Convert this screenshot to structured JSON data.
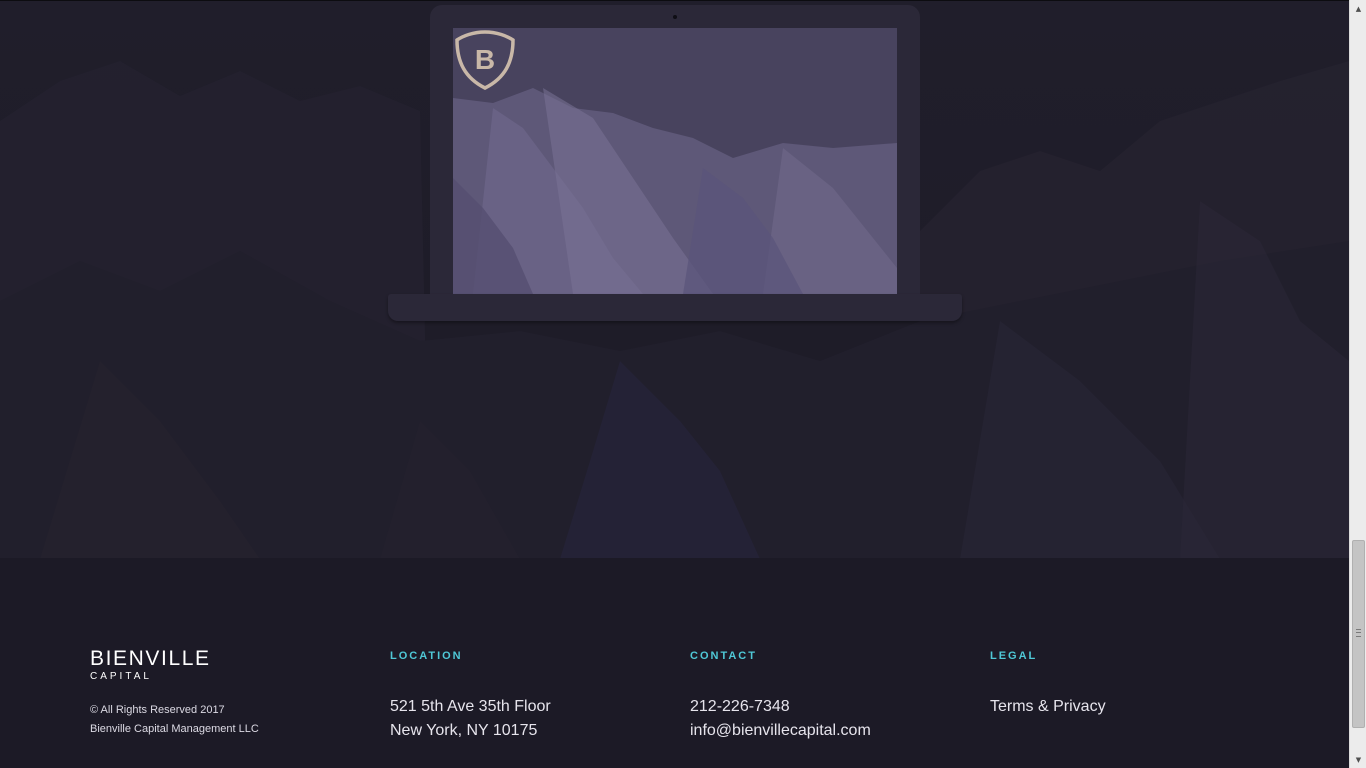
{
  "brand": {
    "name": "BIENVILLE",
    "sub": "CAPITAL",
    "logo_letter": "B"
  },
  "copyright": {
    "line1": "© All Rights Reserved 2017",
    "line2": "Bienville Capital Management LLC"
  },
  "location": {
    "heading": "LOCATION",
    "line1": "521 5th Ave 35th Floor",
    "line2": "New York, NY 10175"
  },
  "contact": {
    "heading": "CONTACT",
    "phone": "212-226-7348",
    "email": "info@bienvillecapital.com"
  },
  "legal": {
    "heading": "LEGAL",
    "link": "Terms & Privacy"
  },
  "colors": {
    "background": "#1c1a26",
    "accent": "#4fc8d6",
    "logo": "#c9b8a8",
    "screen": "#4a4560"
  },
  "icons": {
    "logo": "shield-b-icon",
    "scroll_up": "scroll-up-arrow-icon",
    "scroll_down": "scroll-down-arrow-icon"
  }
}
